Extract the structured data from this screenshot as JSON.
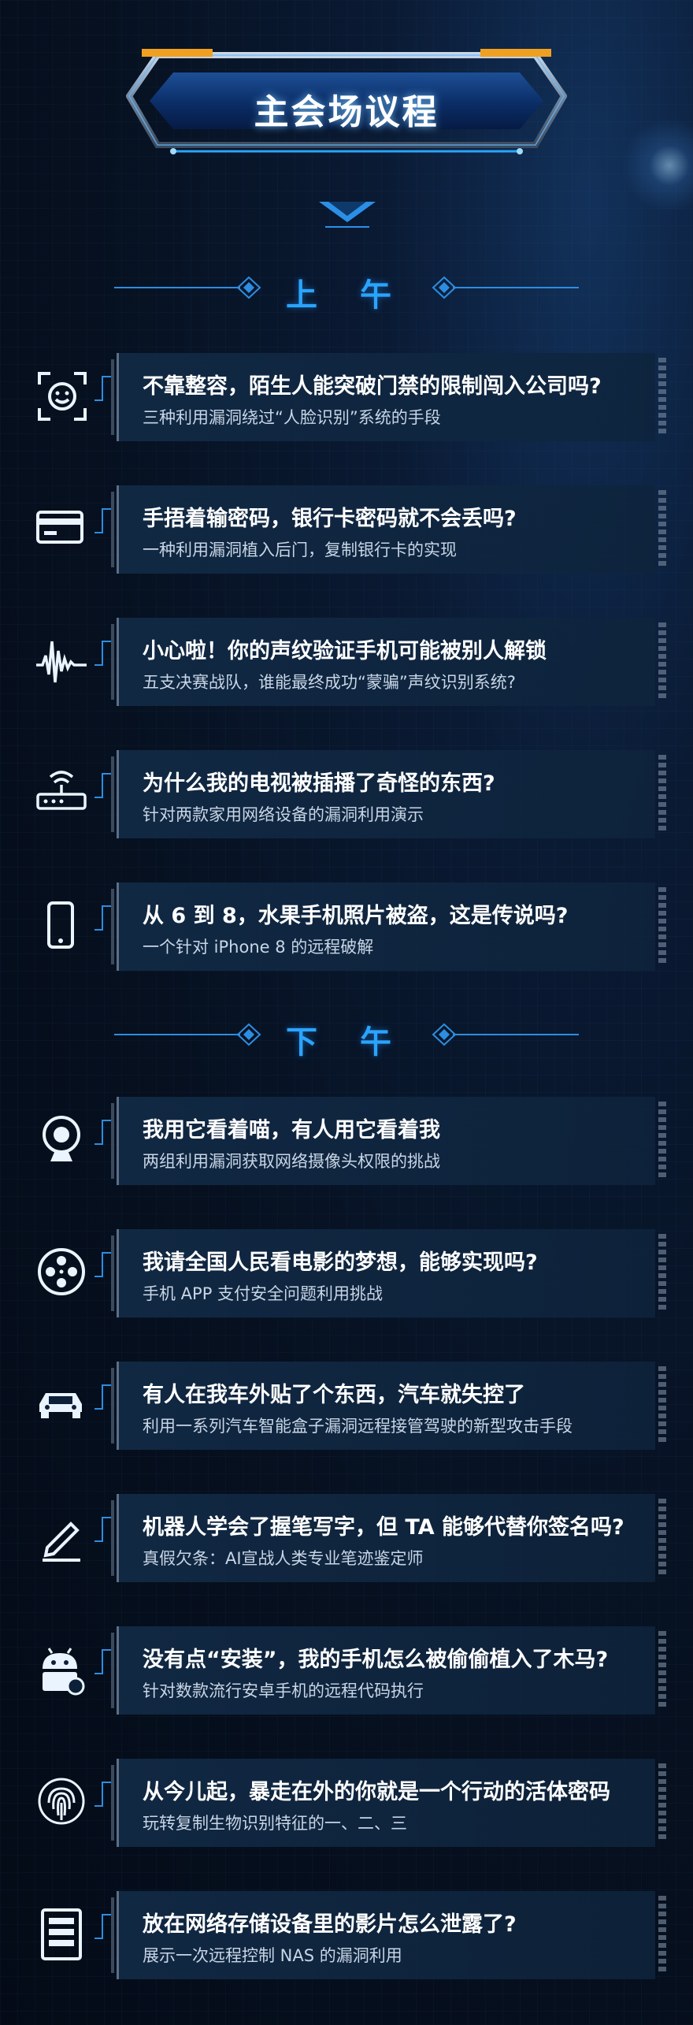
{
  "header": {
    "title": "主会场议程"
  },
  "sections": [
    {
      "label": "上 午",
      "items": [
        {
          "icon": "face-recognition-icon",
          "title": "不靠整容，陌生人能突破门禁的限制闯入公司吗?",
          "subtitle": "三种利用漏洞绕过“人脸识别”系统的手段"
        },
        {
          "icon": "bank-card-icon",
          "title": "手捂着输密码，银行卡密码就不会丢吗?",
          "subtitle": "一种利用漏洞植入后门，复制银行卡的实现"
        },
        {
          "icon": "voice-wave-icon",
          "title": "小心啦！你的声纹验证手机可能被别人解锁",
          "subtitle": "五支决赛战队，谁能最终成功“蒙骗”声纹识别系统?"
        },
        {
          "icon": "router-icon",
          "title": "为什么我的电视被插播了奇怪的东西?",
          "subtitle": "针对两款家用网络设备的漏洞利用演示"
        },
        {
          "icon": "phone-icon",
          "title": "从 6 到 8，水果手机照片被盗，这是传说吗?",
          "subtitle": "一个针对 iPhone 8 的远程破解"
        }
      ]
    },
    {
      "label": "下 午",
      "items": [
        {
          "icon": "webcam-icon",
          "title": "我用它看着喵，有人用它看着我",
          "subtitle": "两组利用漏洞获取网络摄像头权限的挑战"
        },
        {
          "icon": "film-reel-icon",
          "title": "我请全国人民看电影的梦想，能够实现吗?",
          "subtitle": "手机 APP 支付安全问题利用挑战"
        },
        {
          "icon": "car-icon",
          "title": "有人在我车外贴了个东西，汽车就失控了",
          "subtitle": "利用一系列汽车智能盒子漏洞远程接管驾驶的新型攻击手段"
        },
        {
          "icon": "pen-icon",
          "title": "机器人学会了握笔写字，但 TA 能够代替你签名吗?",
          "subtitle": "真假欠条：AI宣战人类专业笔迹鉴定师"
        },
        {
          "icon": "android-bug-icon",
          "title": "没有点“安装”，我的手机怎么被偷偷植入了木马?",
          "subtitle": "针对数款流行安卓手机的远程代码执行"
        },
        {
          "icon": "fingerprint-icon",
          "title": "从今儿起，暴走在外的你就是一个行动的活体密码",
          "subtitle": "玩转复制生物识别特征的一、二、三"
        },
        {
          "icon": "nas-server-icon",
          "title": "放在网络存储设备里的影片怎么泄露了?",
          "subtitle": "展示一次远程控制 NAS 的漏洞利用"
        }
      ]
    }
  ]
}
